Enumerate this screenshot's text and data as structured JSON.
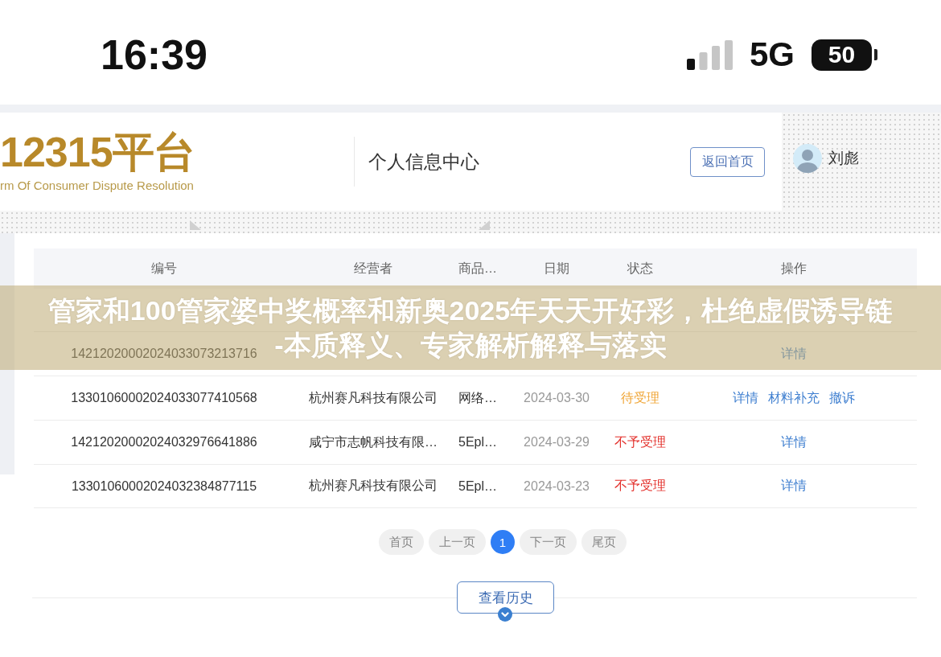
{
  "status_bar": {
    "time": "16:39",
    "network": "5G",
    "battery": "50"
  },
  "header": {
    "logo": "12315平台",
    "logo_subtitle": "rm Of Consumer Dispute Resolution",
    "page_title": "个人信息中心",
    "home_button": "返回首页",
    "user_name": "刘彪"
  },
  "table": {
    "columns": [
      "编号",
      "经营者",
      "商品…",
      "日期",
      "状态",
      "操作"
    ],
    "rows": [
      {
        "id": "14212020002024033073213716",
        "actions": [
          "详情"
        ]
      },
      {
        "id": "13301060002024033077410568",
        "operator": "杭州赛凡科技有限公司",
        "product": "网络…",
        "date": "2024-03-30",
        "status": {
          "text": "待受理",
          "color": "#f0a535"
        },
        "actions": [
          "详情",
          "材料补充",
          "撤诉"
        ]
      },
      {
        "id": "14212020002024032976641886",
        "operator": "咸宁市志帆科技有限…",
        "product": "5Epl…",
        "date": "2024-03-29",
        "status": {
          "text": "不予受理",
          "color": "#e3302b"
        },
        "actions": [
          "详情"
        ]
      },
      {
        "id": "13301060002024032384877115",
        "operator": "杭州赛凡科技有限公司",
        "product": "5Epl…",
        "date": "2024-03-23",
        "status": {
          "text": "不予受理",
          "color": "#e3302b"
        },
        "actions": [
          "详情"
        ]
      }
    ]
  },
  "pagination": [
    {
      "label": "首页",
      "selected": false
    },
    {
      "label": "上一页",
      "selected": false
    },
    {
      "label": "1",
      "selected": true
    },
    {
      "label": "下一页",
      "selected": false
    },
    {
      "label": "尾页",
      "selected": false
    }
  ],
  "history_button": "查看历史",
  "caption_banner": "管家和100管家婆中奖概率和新奥2025年天天开好彩，杜绝虚假诱导链\n-本质释义、专家解析解释与落实"
}
